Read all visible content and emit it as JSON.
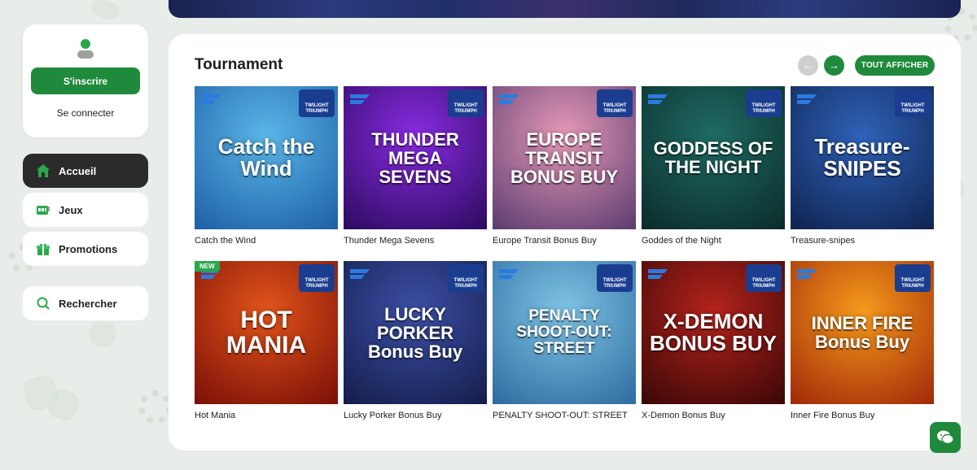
{
  "auth": {
    "signup_label": "S'inscrire",
    "login_label": "Se connecter"
  },
  "nav": {
    "items": [
      {
        "label": "Accueil",
        "icon": "home-icon",
        "active": true
      },
      {
        "label": "Jeux",
        "icon": "slot-machine-icon",
        "active": false
      },
      {
        "label": "Promotions",
        "icon": "gift-icon",
        "active": false
      }
    ],
    "search_label": "Rechercher"
  },
  "section": {
    "title": "Tournament",
    "view_all_label": "TOUT AFFICHER"
  },
  "tile_badge": {
    "line1": "TWILIGHT",
    "line2": "TRIUMPH"
  },
  "new_badge": "NEW",
  "games": [
    {
      "name": "Catch the Wind",
      "art_title": "Catch the Wind",
      "bg": [
        "#5ab6e8",
        "#1d5fa5"
      ],
      "is_new": false
    },
    {
      "name": "Thunder Mega Sevens",
      "art_title": "THUNDER MEGA SEVENS",
      "bg": [
        "#8a2be2",
        "#2b0b5e"
      ],
      "is_new": false
    },
    {
      "name": "Europe Transit Bonus Buy",
      "art_title": "EUROPE TRANSIT BONUS BUY",
      "bg": [
        "#e79ab8",
        "#5a3b6f"
      ],
      "is_new": false
    },
    {
      "name": "Goddes of the Night",
      "art_title": "GODDESS OF THE NIGHT",
      "bg": [
        "#1f6b63",
        "#0b2b2a"
      ],
      "is_new": false
    },
    {
      "name": "Treasure-snipes",
      "art_title": "Treasure-SNIPES",
      "bg": [
        "#2f62b8",
        "#0f2350"
      ],
      "is_new": false
    },
    {
      "name": "Hot Mania",
      "art_title": "HOT MANIA",
      "bg": [
        "#e2541a",
        "#7a0f07"
      ],
      "is_new": true
    },
    {
      "name": "Lucky Porker Bonus Buy",
      "art_title": "LUCKY PORKER Bonus Buy",
      "bg": [
        "#3c4fa6",
        "#141d4a"
      ],
      "is_new": false
    },
    {
      "name": "PENALTY SHOOT-OUT: STREET",
      "art_title": "PENALTY SHOOT-OUT: STREET",
      "bg": [
        "#7fc4e6",
        "#2e6b9e"
      ],
      "is_new": false
    },
    {
      "name": "X-Demon Bonus Buy",
      "art_title": "X-DEMON BONUS BUY",
      "bg": [
        "#b5231c",
        "#3a0706"
      ],
      "is_new": false
    },
    {
      "name": "Inner Fire Bonus Buy",
      "art_title": "INNER FIRE Bonus Buy",
      "bg": [
        "#f59a1c",
        "#a02808"
      ],
      "is_new": false
    }
  ],
  "colors": {
    "accent": "#1f8a3c",
    "active_nav": "#2b2b2b",
    "background": "#e9ede9"
  }
}
